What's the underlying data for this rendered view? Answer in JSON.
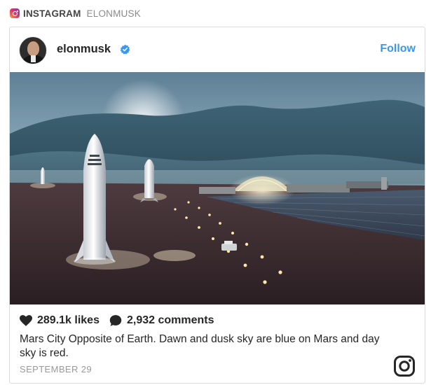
{
  "source": {
    "platform": "INSTAGRAM",
    "account": "ELONMUSK",
    "icon": "instagram-logo-icon",
    "brand_gradient": [
      "#f9a33a",
      "#e1306c",
      "#833ab4"
    ]
  },
  "post": {
    "username": "elonmusk",
    "verified_icon": "verified-badge-icon",
    "verified_color": "#3897f0",
    "follow_label": "Follow",
    "follow_color": "#3897f0",
    "image_description_icon": "mars-city-photo",
    "likes": "289.1k likes",
    "comments": "2,932 comments",
    "caption": "Mars City Opposite of Earth. Dawn and dusk sky are blue on Mars and day sky is red.",
    "date": "SEPTEMBER 29"
  },
  "icons": {
    "heart": "heart-icon",
    "comment": "comment-bubble-icon",
    "instagram": "instagram-glyph-icon"
  }
}
